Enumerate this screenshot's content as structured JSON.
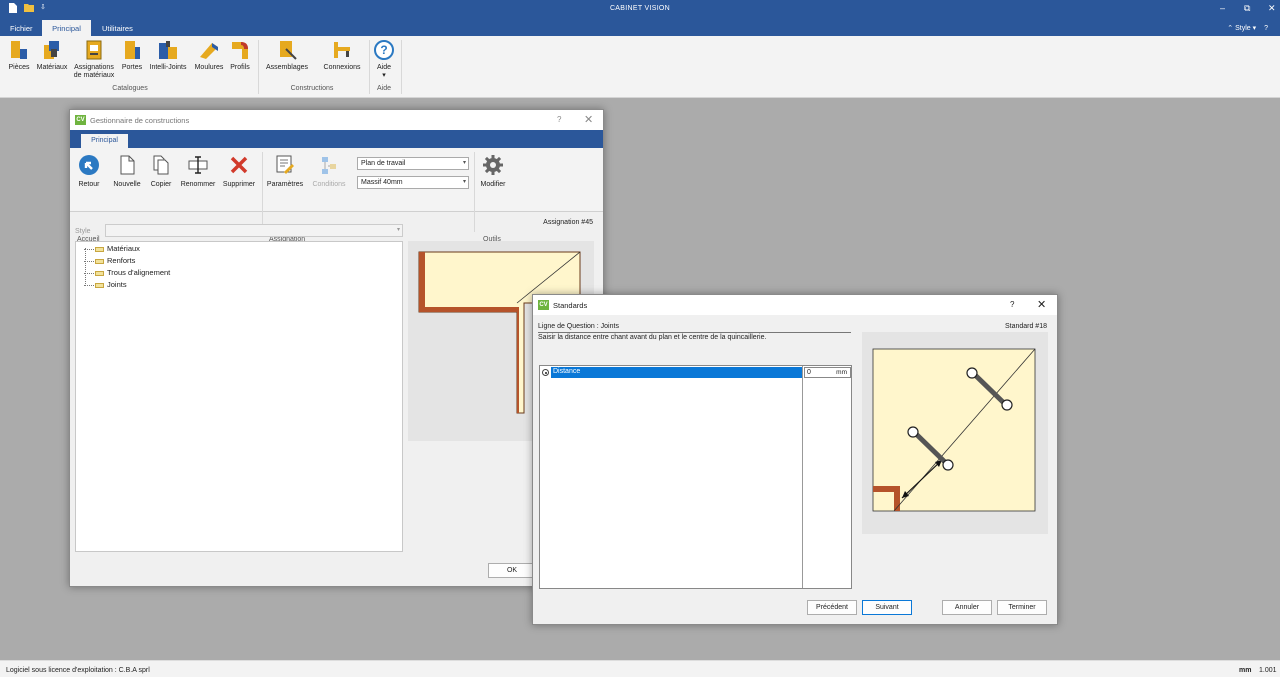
{
  "app": {
    "title": "CABINET VISION",
    "style_label": "Style"
  },
  "ribbon": {
    "tabs": [
      "Fichier",
      "Principal",
      "Utilitaires"
    ],
    "buttons": {
      "pieces": "Pièces",
      "materiaux": "Matériaux",
      "assignations_1": "Assignations",
      "assignations_2": "de matériaux",
      "portes": "Portes",
      "intelli": "Intelli-Joints",
      "moulures": "Moulures",
      "profils": "Profils",
      "assemblages": "Assemblages",
      "connexions": "Connexions",
      "aide": "Aide"
    },
    "groups": {
      "catalogues": "Catalogues",
      "constructions": "Constructions",
      "aide": "Aide"
    }
  },
  "gestionnaire": {
    "title": "Gestionnaire de constructions",
    "help": "?",
    "close": "✕",
    "tab": "Principal",
    "buttons": {
      "retour": "Retour",
      "nouvelle": "Nouvelle",
      "copier": "Copier",
      "renommer": "Renommer",
      "supprimer": "Supprimer",
      "parametres": "Paramètres",
      "conditions": "Conditions",
      "modifier": "Modifier"
    },
    "combo1": "Plan de travail",
    "combo2": "Massif 40mm",
    "groups": {
      "accueil": "Accueil",
      "assignation": "Assignation",
      "outils": "Outils"
    },
    "assignation_num": "Assignation #45",
    "style_label": "Style",
    "tree": [
      "Matériaux",
      "Renforts",
      "Trous d'alignement",
      "Joints"
    ],
    "ok": "OK"
  },
  "standards": {
    "title": "Standards",
    "help": "?",
    "close": "✕",
    "question_label": "Ligne de Question : Joints",
    "description": "Saisir la distance entre chant avant du plan et le centre de la quincaillerie.",
    "standard_num": "Standard #18",
    "row": {
      "label": "Distance",
      "value": "0",
      "unit": "mm"
    },
    "buttons": {
      "precedent": "Précédent",
      "suivant": "Suivant",
      "annuler": "Annuler",
      "terminer": "Terminer"
    }
  },
  "status": {
    "license": "Logiciel sous licence d'exploitation : C.B.A sprl",
    "unit": "mm",
    "scale": "1.001"
  }
}
